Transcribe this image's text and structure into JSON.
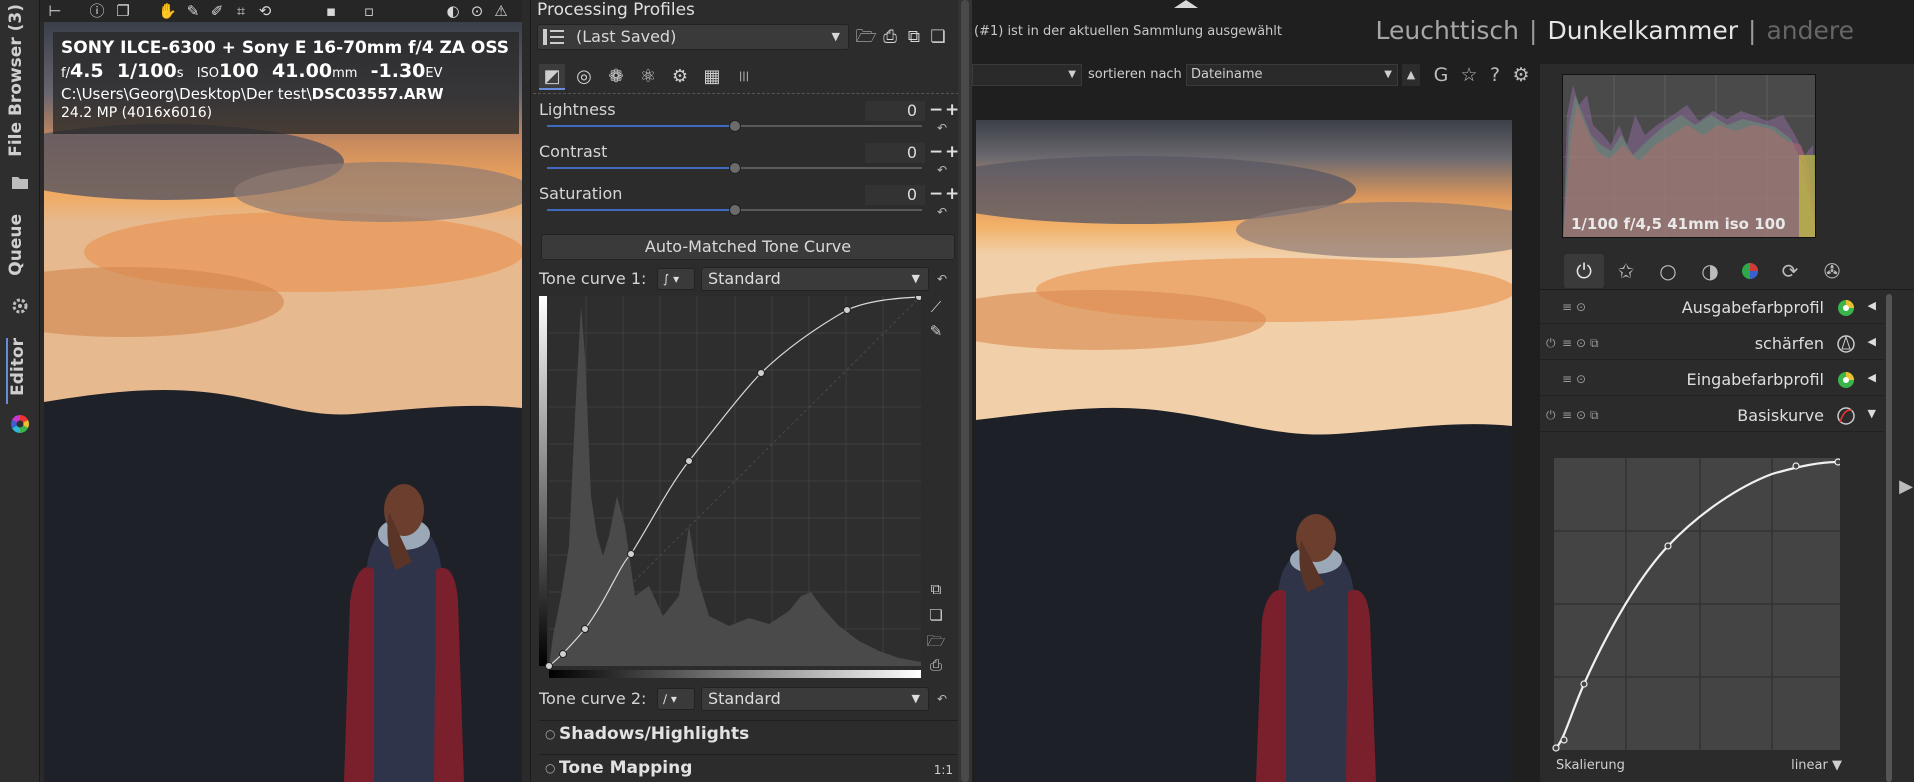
{
  "rawtherapee": {
    "vtabs": {
      "file_browser": "File Browser (3)",
      "queue": "Queue",
      "editor": "Editor"
    },
    "info": {
      "camera": "SONY ILCE-6300 + Sony E 16-70mm f/4 ZA OSS",
      "f_prefix": "f/",
      "aperture": "4.5",
      "shutter": "1/100",
      "shutter_unit": "s",
      "iso_prefix": "ISO",
      "iso": "100",
      "focal": "41.00",
      "focal_unit": "mm",
      "ev": "-1.30",
      "ev_unit": "EV",
      "path_prefix": "C:\\Users\\Georg\\Desktop\\Der test\\",
      "filename": "DSC03557.ARW",
      "megapixels": "24.2 MP (4016x6016)"
    },
    "processing_profiles": {
      "title": "Processing Profiles",
      "selected": "(Last Saved)"
    },
    "tool_tabs": [
      "exposure",
      "details",
      "color",
      "advanced",
      "transform",
      "raw",
      "metadata"
    ],
    "sliders": [
      {
        "label": "Lightness",
        "value": "0"
      },
      {
        "label": "Contrast",
        "value": "0"
      },
      {
        "label": "Saturation",
        "value": "0"
      }
    ],
    "auto_matched_button": "Auto-Matched Tone Curve",
    "tone_curve_1": {
      "label": "Tone curve 1:",
      "mode": "Standard"
    },
    "tone_curve_2": {
      "label": "Tone curve 2:",
      "mode": "Standard"
    },
    "sections": [
      {
        "label": "Shadows/Highlights",
        "extra": ""
      },
      {
        "label": "Tone Mapping",
        "extra": "1:1"
      }
    ]
  },
  "darktable": {
    "info_text": "(#1) ist in der aktuellen Sammlung ausgewählt",
    "views": [
      "Leuchttisch",
      "Dunkelkammer",
      "andere"
    ],
    "active_view": "Dunkelkammer",
    "sort_label": "sortieren nach",
    "sort_value": "Dateiname",
    "toolbar_letter": "G",
    "histogram_text": "1/100 f/4,5 41mm iso 100",
    "modules": [
      {
        "name": "Ausgabefarbprofil",
        "expanded": false
      },
      {
        "name": "schärfen",
        "expanded": false
      },
      {
        "name": "Eingabefarbprofil",
        "expanded": false
      },
      {
        "name": "Basiskurve",
        "expanded": true
      }
    ],
    "basecurve": {
      "scale_label": "Skalierung",
      "scale_value": "linear"
    }
  },
  "colors": {
    "rt_accent": "#3f6bbf",
    "dt_bg": "#1f1f1f",
    "sky_warm": "#f4a55a"
  }
}
